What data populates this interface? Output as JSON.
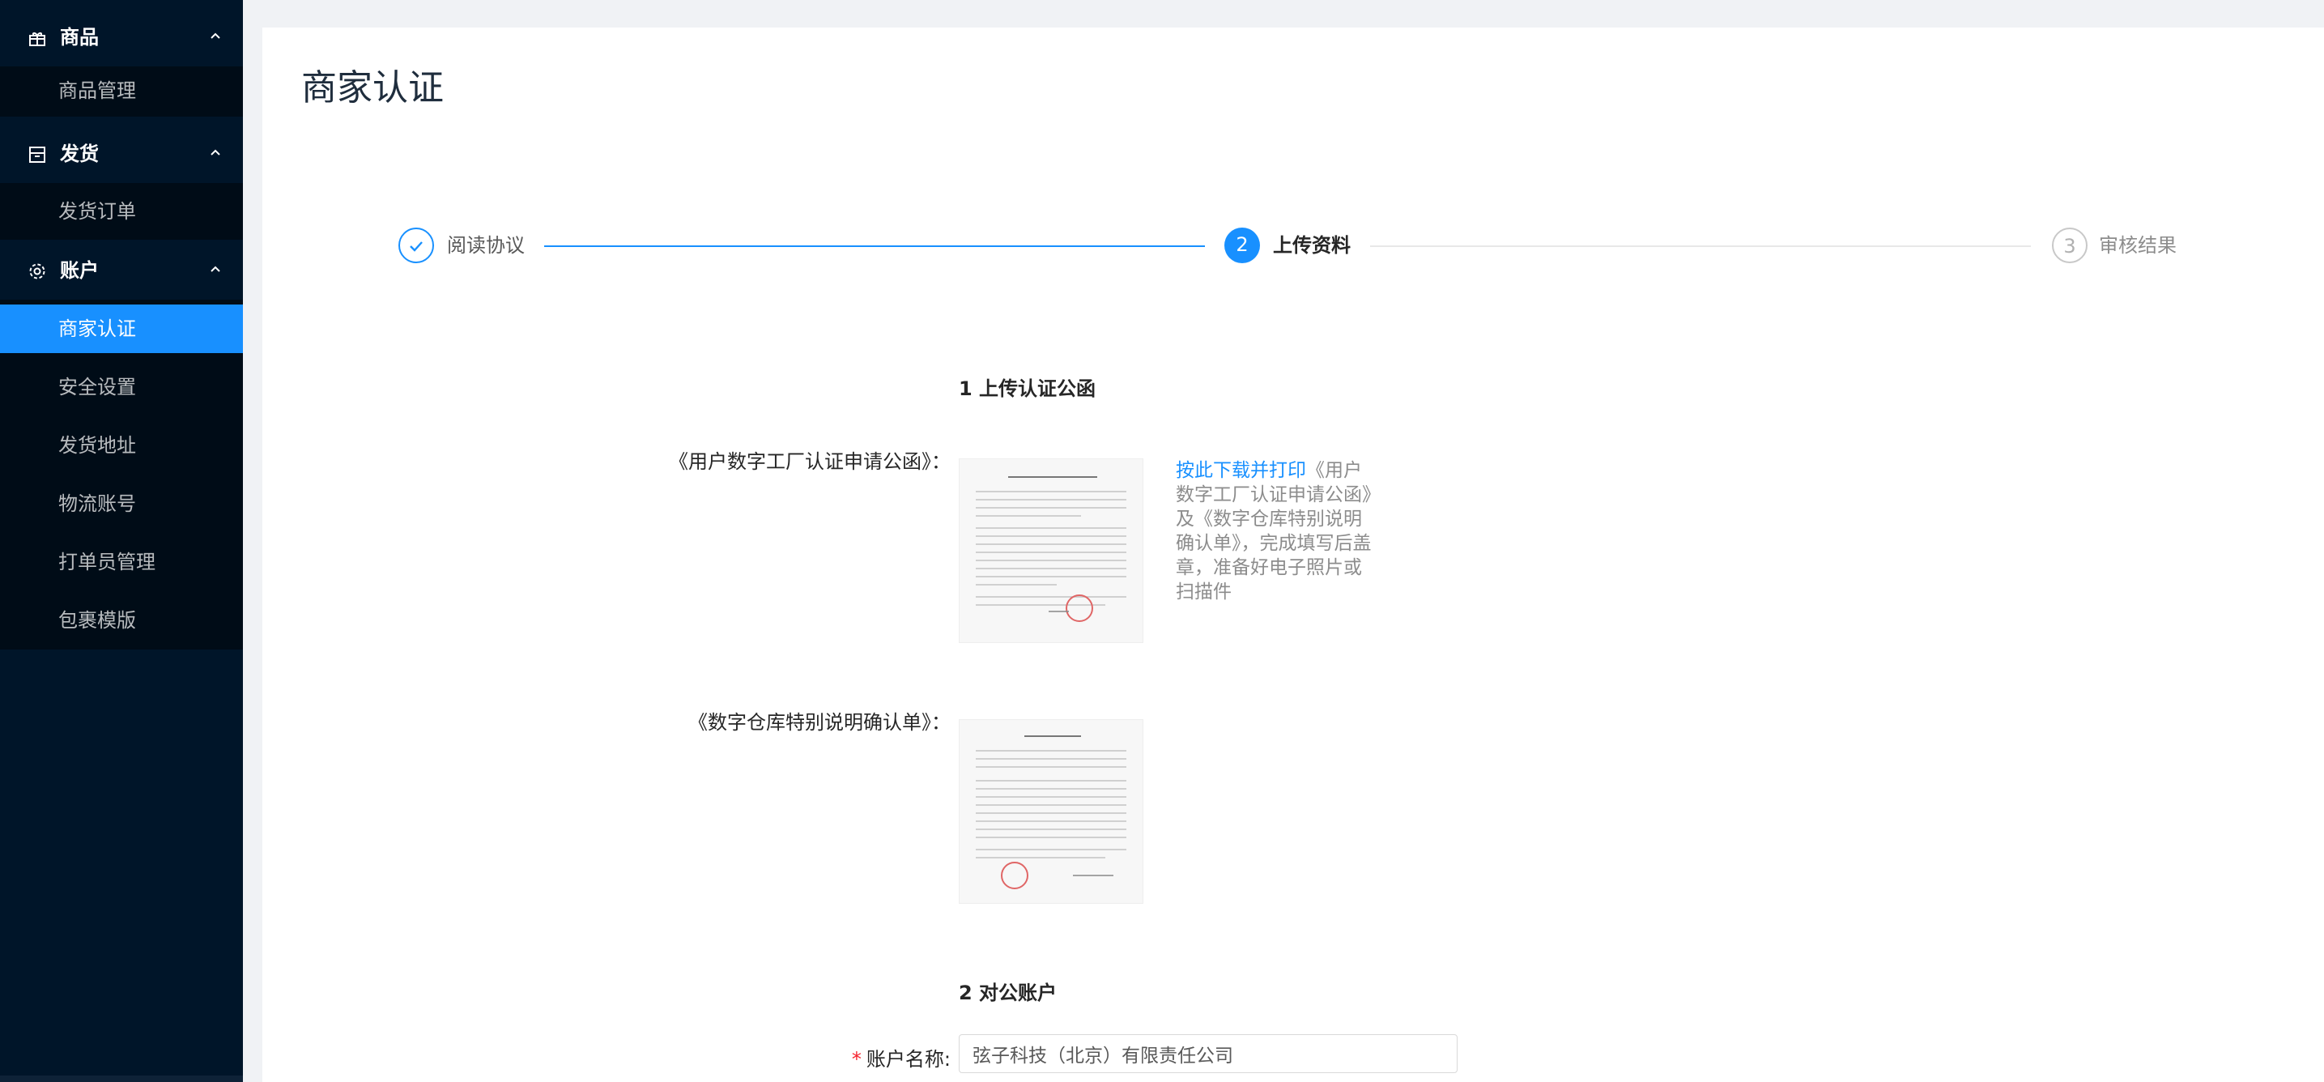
{
  "sidebar": {
    "groups": [
      {
        "label": "商品",
        "icon": "gift-icon",
        "items": [
          {
            "label": "商品管理",
            "active": false
          }
        ]
      },
      {
        "label": "发货",
        "icon": "box-icon",
        "items": [
          {
            "label": "发货订单",
            "active": false
          }
        ]
      },
      {
        "label": "账户",
        "icon": "gear-icon",
        "items": [
          {
            "label": "商家认证",
            "active": true
          },
          {
            "label": "安全设置",
            "active": false
          },
          {
            "label": "发货地址",
            "active": false
          },
          {
            "label": "物流账号",
            "active": false
          },
          {
            "label": "打单员管理",
            "active": false
          },
          {
            "label": "包裹模版",
            "active": false
          }
        ]
      }
    ]
  },
  "page": {
    "title": "商家认证"
  },
  "steps": [
    {
      "number": "",
      "label": "阅读协议",
      "status": "finished"
    },
    {
      "number": "2",
      "label": "上传资料",
      "status": "current"
    },
    {
      "number": "3",
      "label": "审核结果",
      "status": "waiting"
    }
  ],
  "form": {
    "section1_title": "1 上传认证公函",
    "doc1_label": "《用户数字工厂认证申请公函》：",
    "doc2_label": "《数字仓库特别说明确认单》：",
    "help_link": "按此下载并打印",
    "help_text": "《用户数字工厂认证申请公函》及《数字仓库特别说明确认单》，完成填写后盖章，准备好电子照片或扫描件",
    "section2_title": "2 对公账户",
    "required_mark": "*",
    "account_name_label": "账户名称:",
    "account_name_value": "弦子科技（北京）有限责任公司"
  },
  "colors": {
    "sidebar_bg": "#001529",
    "submenu_bg": "#000c17",
    "primary": "#1890ff",
    "required": "#f5222d"
  }
}
